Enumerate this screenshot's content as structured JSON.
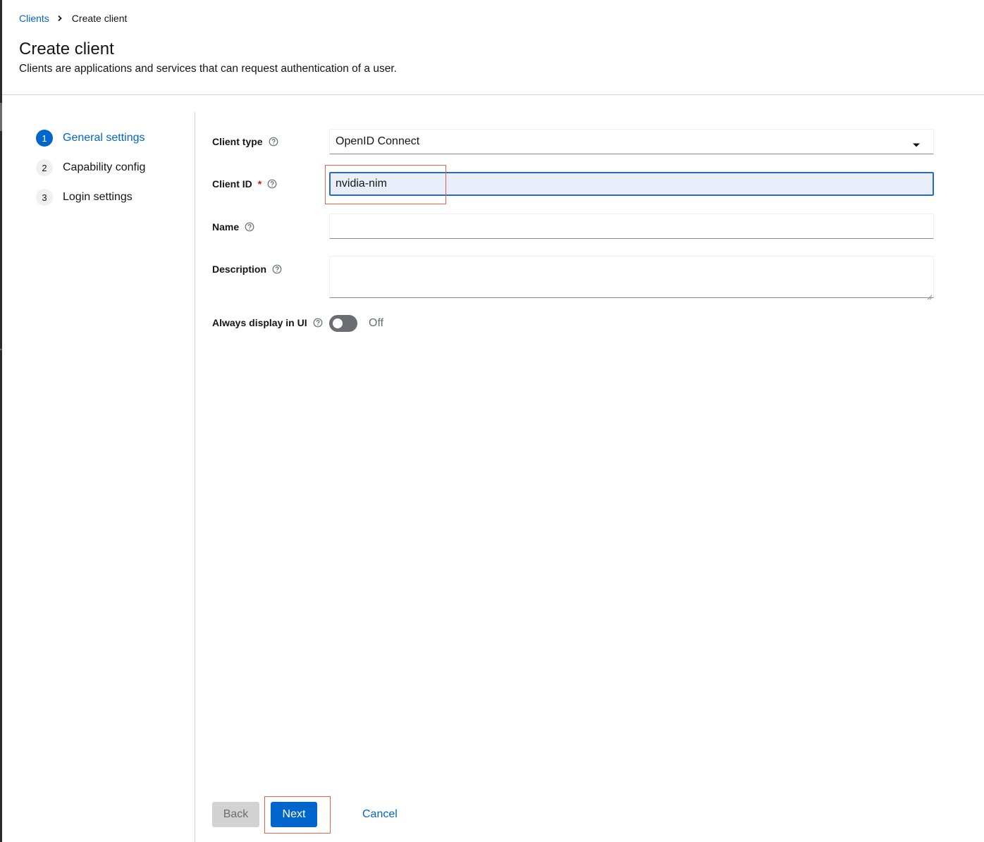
{
  "breadcrumb": {
    "parent": "Clients",
    "current": "Create client"
  },
  "header": {
    "title": "Create client",
    "description": "Clients are applications and services that can request authentication of a user."
  },
  "wizard": {
    "steps": [
      {
        "number": "1",
        "label": "General settings",
        "active": true
      },
      {
        "number": "2",
        "label": "Capability config",
        "active": false
      },
      {
        "number": "3",
        "label": "Login settings",
        "active": false
      }
    ]
  },
  "form": {
    "client_type": {
      "label": "Client type",
      "value": "OpenID Connect"
    },
    "client_id": {
      "label": "Client ID",
      "required_mark": "*",
      "value": "nvidia-nim"
    },
    "name": {
      "label": "Name",
      "value": ""
    },
    "description": {
      "label": "Description",
      "value": ""
    },
    "always_display": {
      "label": "Always display in UI",
      "state": "Off"
    }
  },
  "footer": {
    "back_label": "Back",
    "next_label": "Next",
    "cancel_label": "Cancel"
  },
  "colors": {
    "primary": "#0066cc",
    "required": "#c9190b",
    "highlight": "#e8604c",
    "focus_fill": "#e8effb"
  },
  "icons": {
    "help": "help-circle-icon",
    "separator": "chevron-right-icon",
    "dropdown": "caret-down-icon"
  }
}
